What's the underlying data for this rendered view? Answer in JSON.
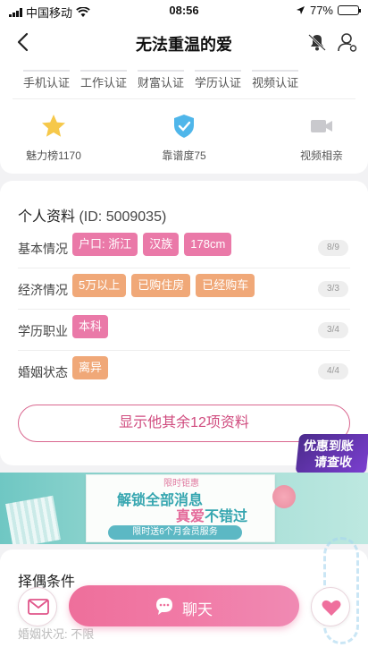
{
  "status_bar": {
    "carrier": "中国移动",
    "time": "08:56",
    "battery": "77%",
    "battery_level": 0.77
  },
  "nav": {
    "title": "无法重温的爱"
  },
  "verifications": [
    "手机认证",
    "工作认证",
    "财富认证",
    "学历认证",
    "视频认证"
  ],
  "badges": [
    {
      "label": "魅力榜1170",
      "icon": "star-icon"
    },
    {
      "label": "靠谱度75",
      "icon": "shield-check-icon"
    },
    {
      "label": "视频相亲",
      "icon": "video-camera-icon"
    }
  ],
  "profile": {
    "title": "个人资料",
    "id_text": "(ID: 5009035)",
    "rows": [
      {
        "label": "基本情况",
        "tags": [
          "户口: 浙江",
          "汉族",
          "178cm"
        ],
        "count": "8/9"
      },
      {
        "label": "经济情况",
        "tags": [
          "5万以上",
          "已购住房",
          "已经购车"
        ],
        "count": "3/3"
      },
      {
        "label": "学历职业",
        "tags": [
          "本科"
        ],
        "count": "3/4"
      },
      {
        "label": "婚姻状态",
        "tags": [
          "离异"
        ],
        "count": "4/4"
      }
    ],
    "show_more": "显示他其余12项资料"
  },
  "promo_badge": {
    "line1": "优惠到账",
    "line2": "请查收"
  },
  "banner": {
    "top": "限时钜惠",
    "headline": "解锁全部消息",
    "headline2_a": "真爱",
    "headline2_b": "不错过",
    "sub": "限时送6个月会员服务"
  },
  "mate": {
    "title": "择偶条件",
    "line": "婚姻状况: 不限"
  },
  "actions": {
    "chat": "聊天"
  },
  "colors": {
    "pink_tag": "#ea79a8",
    "orange_tag": "#f0a878",
    "accent": "#d04c7f"
  }
}
